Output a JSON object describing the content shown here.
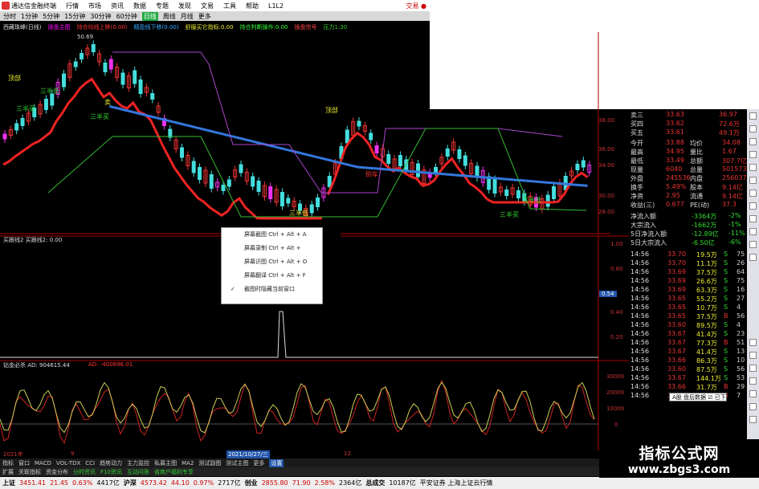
{
  "titlebar": {
    "app": "通达信金融终端",
    "menu": [
      "行情",
      "市场",
      "资讯",
      "数据",
      "专题",
      "发现",
      "文易",
      "工具",
      "帮助",
      "L1L2"
    ],
    "trade": "交易 ●"
  },
  "periods": [
    "分时",
    "1分钟",
    "5分钟",
    "15分钟",
    "30分钟",
    "60分钟",
    "日线",
    "周线",
    "月线",
    "更多"
  ],
  "active_period": "日线",
  "indicators": {
    "name": "西藏珠峰(日线)",
    "items": [
      "操盘主图",
      "持仓均线上移(0.00)",
      "精盈线下移(0.00)",
      "舒服买它指标:0.00",
      "持仓判断操作:0.00",
      "操盘信号",
      "压力1:30"
    ]
  },
  "chart_labels": {
    "high": "50.69",
    "low": "27.94",
    "markers": [
      "顶部",
      "三半买",
      "三半低",
      "卖",
      "三半买",
      "三半低",
      "顶部",
      "倒车",
      "三半买",
      "三半低"
    ]
  },
  "price_axis": [
    "38.00",
    "36.00",
    "34.00",
    "32.00",
    "30.00",
    "28.00"
  ],
  "sub1": {
    "label": "买跟线2 买跟线2: 0.00",
    "axis": [
      "1.00",
      "0.80",
      "0.60",
      "0.54",
      "0.40",
      "0.20"
    ]
  },
  "sub2": {
    "label": "钻金必杀 AD: 904615.44",
    "label2": "AD: -400896.01",
    "axis": [
      "30000",
      "20000",
      "10000",
      "0"
    ]
  },
  "dates": [
    "2021年",
    "9",
    "2021/10/27/三",
    "12"
  ],
  "menu": [
    "屏幕截图 Ctrl + Alt + A",
    "屏幕录制 Ctrl + Alt +",
    "屏幕识图 Ctrl + Alt + O",
    "屏幕翻译 Ctrl + Alt + F",
    "截图时隐藏当前窗口"
  ],
  "quote": {
    "rows": [
      [
        "卖三",
        "33.63",
        "36.97"
      ],
      [
        "买四",
        "33.62",
        "72.6万"
      ],
      [
        "买五",
        "33.61",
        "49.1万"
      ],
      [
        "今开",
        "33.88",
        "均价",
        "34.08"
      ],
      [
        "最高",
        "34.95",
        "量比",
        "1.67"
      ],
      [
        "最低",
        "33.49",
        "总额",
        "307.7亿"
      ],
      [
        "现量",
        "6040",
        "总量",
        "501573"
      ],
      [
        "外盘",
        "245536",
        "内盘",
        "256037"
      ],
      [
        "换手",
        "5.49%",
        "股本",
        "9.14亿"
      ],
      [
        "净资",
        "2.95",
        "流通",
        "9.14亿"
      ],
      [
        "收益(三)",
        "0.677",
        "PE(动)",
        "37.3"
      ]
    ],
    "flows": [
      [
        "净流入额",
        "-3364万",
        "-2%"
      ],
      [
        "大宗流入",
        "-1662万",
        "-1%"
      ],
      [
        "5日净流入额",
        "-12.89亿",
        "-11%"
      ],
      [
        "5日大宗流入",
        "-6.50亿",
        "-6%"
      ]
    ],
    "ticks": [
      [
        "14:56",
        "33.70",
        "19.5万",
        "S",
        "75"
      ],
      [
        "14:56",
        "33.70",
        "11.1万",
        "S",
        "26"
      ],
      [
        "14:56",
        "33.69",
        "37.5万",
        "S",
        "64"
      ],
      [
        "14:56",
        "33.69",
        "26.6万",
        "S",
        "75"
      ],
      [
        "14:56",
        "33.69",
        "63.3万",
        "S",
        "16"
      ],
      [
        "14:56",
        "33.65",
        "55.2万",
        "S",
        "27"
      ],
      [
        "14:56",
        "33.65",
        "10.7万",
        "S",
        "4"
      ],
      [
        "14:56",
        "33.65",
        "37.5万",
        "B",
        "56"
      ],
      [
        "14:56",
        "33.60",
        "89.5万",
        "S",
        "4"
      ],
      [
        "14:56",
        "33.67",
        "41.4万",
        "S",
        "23"
      ],
      [
        "14:56",
        "33.67",
        "77.3万",
        "B",
        "51"
      ],
      [
        "14:56",
        "33.67",
        "41.4万",
        "S",
        "13"
      ],
      [
        "14:56",
        "33.66",
        "86.3万",
        "S",
        "10"
      ],
      [
        "14:56",
        "33.60",
        "87.5万",
        "S",
        "56"
      ],
      [
        "14:56",
        "33.67",
        "144.1万",
        "S",
        "53"
      ],
      [
        "14:56",
        "33.66",
        "31.7万",
        "B",
        "29"
      ],
      [
        "14:56",
        "33.66",
        "31.9万",
        "B",
        "7"
      ]
    ]
  },
  "tip": "A股 盘后数据 ☑ 已下载",
  "bottom_tabs": [
    "指标",
    "窗口",
    "MACD",
    "VOL-TDX",
    "CCI",
    "趋势动力",
    "主力监控",
    "私募主图",
    "MA2",
    "测试副图",
    "测试主图",
    "更多",
    "设置"
  ],
  "bottom_tabs2": [
    "扩展",
    "关联指标",
    "资金分布",
    "分时资讯",
    "F10资讯",
    "互动问答",
    "省商户福利专享"
  ],
  "status": [
    [
      "上证",
      "3451.41",
      "21.45",
      "0.63%",
      "4417亿"
    ],
    [
      "沪深",
      "4573.42",
      "44.10",
      "0.97%",
      "2717亿"
    ],
    [
      "创业",
      "2855.80",
      "71.90",
      "2.58%",
      "2364亿"
    ],
    [
      "总成交",
      "10187亿"
    ]
  ],
  "status_tail": "平安证券 上海上证云行情",
  "watermark": {
    "line1": "指标公式网",
    "line2": "www.zbgs3.com"
  }
}
